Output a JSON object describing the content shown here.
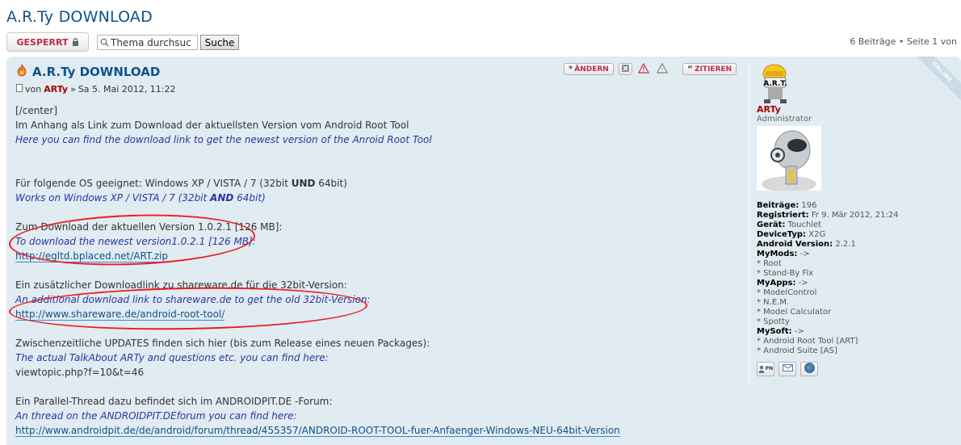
{
  "page": {
    "title": "A.R.Ty DOWNLOAD",
    "locked_label": "GESPERRT",
    "search_placeholder": "Thema durchsuchen…",
    "search_value": "Thema durchsuc",
    "search_button": "Suche",
    "pagination": "6 Beiträge • Seite 1 von"
  },
  "post": {
    "title": "A.R.Ty DOWNLOAD",
    "meta_prefix": "von",
    "author": "ARTy",
    "meta_sep": "»",
    "date": "Sa 5. Mai 2012, 11:22",
    "online_badge": "ONLINE",
    "actions": {
      "edit": "ÄNDERN",
      "quote": "ZITIEREN"
    },
    "body": {
      "l1": "[/center]",
      "l2": "Im Anhang als Link zum Download der aktuellsten Version vom Android Root Tool",
      "l3": "Here you can find the download link to get the newest version of the Anroid Root Tool",
      "l4a": "Für folgende OS geeignet: Windows XP / VISTA / 7 (32bit ",
      "l4b": "UND",
      "l4c": " 64bit)",
      "l5a": "Works on Windows XP / VISTA / 7 (32bit ",
      "l5b": "AND",
      "l5c": " 64bit)",
      "l6": "Zum Download der aktuellen Version 1.0.2.1 [126 MB]:",
      "l7": "To download the newest version1.0.2.1 [126 MB]:",
      "l8": "http://egltd.bplaced.net/ART.zip",
      "l9": "Ein zusätzlicher Downloadlink zu shareware.de für die 32bit-Version:",
      "l10": "An additional download link to shareware.de to get the old 32bit-Version:",
      "l11": "http://www.shareware.de/android-root-tool/",
      "l12": "Zwischenzeitliche UPDATES finden sich hier (bis zum Release eines neuen Packages):",
      "l13": "The actual TalkAbout ARTy and questions etc. you can find here:",
      "l14": "viewtopic.php?f=10&t=46",
      "l15": "Ein Parallel-Thread dazu befindet sich im ANDROIDPIT.DE -Forum:",
      "l16": "An thread on the ANDROIDPIT.DEforum you can find here:",
      "l17": "http://www.androidpit.de/de/android/forum/thread/455357/ANDROID-ROOT-TOOL-fuer-Anfaenger-Windows-NEU-64bit-Version"
    }
  },
  "profile": {
    "rank_image_text": "A.R.T.",
    "username": "ARTy",
    "rank": "Administrator",
    "fields": {
      "posts_label": "Beiträge:",
      "posts_value": "196",
      "registered_label": "Registriert:",
      "registered_value": "Fr 9. Mär 2012, 21:24",
      "device_label": "Gerät:",
      "device_value": "Touchlet",
      "devicetype_label": "DeviceTyp:",
      "devicetype_value": "X2G",
      "android_label": "Android Version:",
      "android_value": "2.2.1",
      "mymods_label": "MyMods:",
      "mymods_value": "->",
      "mymods_1": "* Root",
      "mymods_2": "* Stand-By Fix",
      "myapps_label": "MyApps:",
      "myapps_value": "->",
      "myapps_1": "* ModelControl",
      "myapps_2": "* N.E.M.",
      "myapps_3": "* Model Calculator",
      "myapps_4": "* Spotty",
      "mysoft_label": "MySoft:",
      "mysoft_value": "->",
      "mysoft_1": "* Android Root Tool [ART]",
      "mysoft_2": "* Android Suite [AS]"
    },
    "contact": {
      "pm_label": "PN"
    }
  },
  "colors": {
    "post_bg": "#e1ebf2",
    "link": "#105289",
    "english_text": "#2a36a0",
    "highlight_ellipse": "#e8201f",
    "author": "#aa0000"
  }
}
